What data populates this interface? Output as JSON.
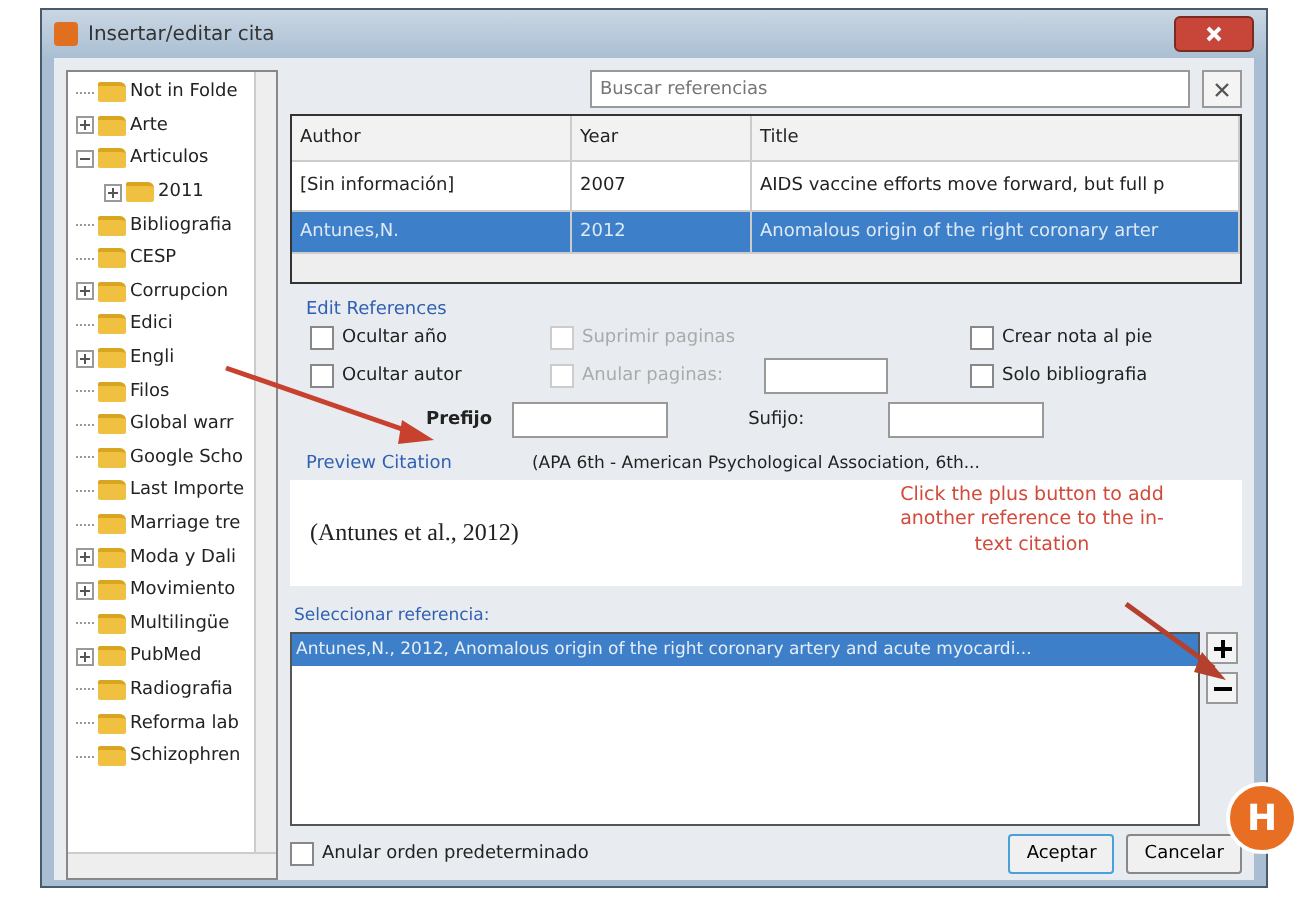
{
  "window": {
    "title": "Insertar/editar cita"
  },
  "tree": [
    {
      "label": "Not in Folde"
    },
    {
      "label": "Arte",
      "expanded": false
    },
    {
      "label": "Articulos",
      "expanded": true,
      "children": [
        {
          "label": "2011",
          "expanded": false
        }
      ]
    },
    {
      "label": "Bibliografia"
    },
    {
      "label": "CESP"
    },
    {
      "label": "Corrupcion",
      "expanded": false
    },
    {
      "label": "Edici"
    },
    {
      "label": "Engli",
      "expanded": false
    },
    {
      "label": "Filos"
    },
    {
      "label": "Global warr"
    },
    {
      "label": "Google Scho"
    },
    {
      "label": "Last Importe"
    },
    {
      "label": "Marriage tre"
    },
    {
      "label": "Moda y Dali",
      "expanded": false
    },
    {
      "label": "Movimiento",
      "expanded": false
    },
    {
      "label": "Multilingüe"
    },
    {
      "label": "PubMed",
      "expanded": false
    },
    {
      "label": "Radiografia"
    },
    {
      "label": "Reforma lab"
    },
    {
      "label": "Schizophren"
    }
  ],
  "search": {
    "placeholder": "Buscar referencias"
  },
  "table": {
    "columns": [
      "Author",
      "Year",
      "Title"
    ],
    "rows": [
      {
        "cells": [
          "[Sin información]",
          "2007",
          "AIDS vaccine efforts move forward, but full p"
        ],
        "selected": false
      },
      {
        "cells": [
          "Antunes,N.",
          "2012",
          "Anomalous origin of the right coronary arter"
        ],
        "selected": true
      }
    ]
  },
  "edit_references": {
    "heading": "Edit References",
    "options": [
      {
        "label": "Ocultar año",
        "checked": false,
        "disabled": false
      },
      {
        "label": "Suprimir paginas",
        "checked": false,
        "disabled": true
      },
      {
        "label": "Crear nota al pie",
        "checked": false,
        "disabled": false
      },
      {
        "label": "Ocultar autor",
        "checked": false,
        "disabled": false
      },
      {
        "label": "Anular paginas:",
        "checked": false,
        "disabled": true
      },
      {
        "label": "Solo bibliografia",
        "checked": false,
        "disabled": false
      }
    ],
    "prefix_label": "Prefijo",
    "suffix_label": "Sufijo:"
  },
  "preview": {
    "label": "Preview Citation",
    "style": "(APA 6th - American Psychological Association, 6th...",
    "citation": "(Antunes et al., 2012)"
  },
  "selected_references": {
    "label": "Seleccionar referencia:",
    "items": [
      {
        "text": "Antunes,N., 2012, Anomalous origin of the right coronary artery and acute myocardi...",
        "selected": true
      }
    ]
  },
  "annotation": {
    "text": "Click the plus button to add another reference to the in-text citation"
  },
  "badge": "H",
  "override_order": {
    "label": "Anular orden predeterminado",
    "checked": false
  },
  "buttons": [
    "Aceptar",
    "Cancelar"
  ]
}
